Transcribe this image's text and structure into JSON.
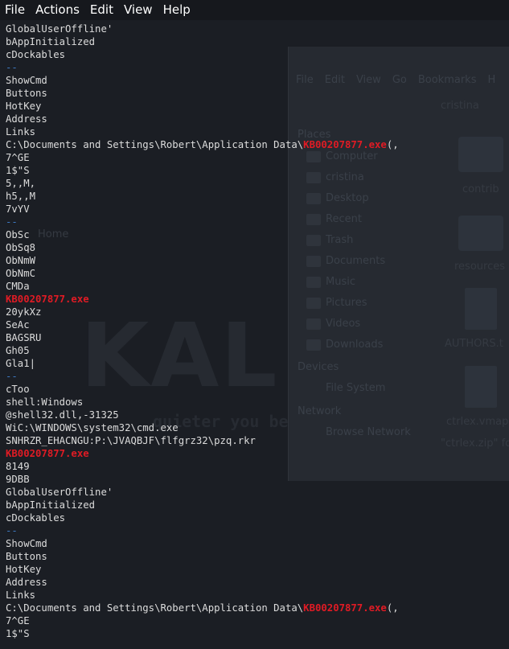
{
  "menubar": {
    "items": [
      "File",
      "Actions",
      "Edit",
      "View",
      "Help"
    ]
  },
  "colors": {
    "background": "#1b1e24",
    "text": "#dcdcdc",
    "separator": "#3d79c2",
    "highlight": "#e01b24"
  },
  "terminal": {
    "lines": [
      {
        "text": "GlobalUserOffline'"
      },
      {
        "text": "bAppInitialized"
      },
      {
        "text": "cDockables"
      },
      {
        "text": "--",
        "kind": "sep"
      },
      {
        "text": "ShowCmd"
      },
      {
        "text": "Buttons"
      },
      {
        "text": "HotKey"
      },
      {
        "text": "Address"
      },
      {
        "text": "Links"
      },
      {
        "pre": "C:\\Documents and Settings\\Robert\\Application Data\\",
        "hl": "KB00207877.exe",
        "post": "(,"
      },
      {
        "text": "7^GE"
      },
      {
        "text": "1$\"S"
      },
      {
        "text": "5,,M,"
      },
      {
        "text": "h5,,M"
      },
      {
        "text": "7vYV"
      },
      {
        "text": "--",
        "kind": "sep"
      },
      {
        "text": "ObSc"
      },
      {
        "text": "ObSq8"
      },
      {
        "text": "ObNmW"
      },
      {
        "text": "ObNmC"
      },
      {
        "text": "CMDa"
      },
      {
        "pre": "",
        "hl": "KB00207877.exe",
        "post": ""
      },
      {
        "text": "20ykXz"
      },
      {
        "text": "SeAc"
      },
      {
        "text": "BAGSRU"
      },
      {
        "text": "Gh05"
      },
      {
        "text": "Gla1|"
      },
      {
        "text": "--",
        "kind": "sep"
      },
      {
        "text": "cToo"
      },
      {
        "text": "shell:Windows"
      },
      {
        "text": "@shell32.dll,-31325"
      },
      {
        "text": "WiC:\\WINDOWS\\system32\\cmd.exe"
      },
      {
        "text": "SNHRZR_EHACNGU:P:\\JVAQBJF\\flfgrz32\\pzq.rkr"
      },
      {
        "pre": "",
        "hl": "KB00207877.exe",
        "post": ""
      },
      {
        "text": "8149"
      },
      {
        "text": "9DBB"
      },
      {
        "text": "GlobalUserOffline'"
      },
      {
        "text": "bAppInitialized"
      },
      {
        "text": "cDockables"
      },
      {
        "text": "--",
        "kind": "sep"
      },
      {
        "text": "ShowCmd"
      },
      {
        "text": "Buttons"
      },
      {
        "text": "HotKey"
      },
      {
        "text": "Address"
      },
      {
        "text": "Links"
      },
      {
        "pre": "C:\\Documents and Settings\\Robert\\Application Data\\",
        "hl": "KB00207877.exe",
        "post": "(,"
      },
      {
        "text": "7^GE"
      },
      {
        "text": "1$\"S"
      }
    ]
  },
  "background": {
    "file_manager_menu": [
      "File",
      "Edit",
      "View",
      "Go",
      "Bookmarks",
      "H"
    ],
    "location": "cristina",
    "places_header": "Places",
    "places": [
      "Computer",
      "cristina",
      "Desktop",
      "Recent",
      "Trash",
      "Documents",
      "Music",
      "Pictures",
      "Videos",
      "Downloads"
    ],
    "devices_header": "Devices",
    "devices": [
      "File System"
    ],
    "network_header": "Network",
    "network": [
      "Browse Network"
    ],
    "files": [
      "contrib",
      "resources",
      "AUTHORS.t",
      "ctrlex.vmap",
      "\"ctrlex.zip\" fo"
    ],
    "home_label": "Home",
    "wallpaper_word": "KAL",
    "wallpaper_tagline": "quieter you be"
  }
}
